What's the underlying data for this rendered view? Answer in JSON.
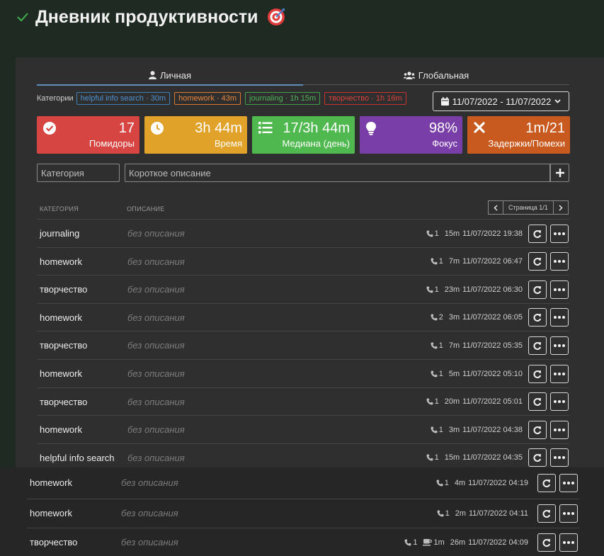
{
  "header": {
    "title": "Дневник продуктивности"
  },
  "tabs": [
    {
      "label": "Личная",
      "active": true
    },
    {
      "label": "Глобальная",
      "active": false
    }
  ],
  "categories": {
    "label": "Категории",
    "tags": [
      {
        "text": "helpful info search · 30m",
        "color": "#3f7fb8"
      },
      {
        "text": "homework · 43m",
        "color": "#e07a30"
      },
      {
        "text": "journaling · 1h 15m",
        "color": "#3fa14b"
      },
      {
        "text": "творчество · 1h 16m",
        "color": "#c8332f"
      }
    ]
  },
  "date_range": "11/07/2022 - 11/07/2022",
  "stats": [
    {
      "value": "17",
      "label": "Помидоры",
      "color": "#d64541",
      "icon": "check-circle-icon"
    },
    {
      "value": "3h 44m",
      "label": "Время",
      "color": "#e0a229",
      "icon": "clock-icon"
    },
    {
      "value": "17/3h 44m",
      "label": "Медиана (день)",
      "color": "#4fb84f",
      "icon": "list-icon"
    },
    {
      "value": "98%",
      "label": "Фокус",
      "color": "#7a3ea8",
      "icon": "lightbulb-icon"
    },
    {
      "value": "1m/21",
      "label": "Задержки/Помехи",
      "color": "#c95a1f",
      "icon": "times-icon"
    }
  ],
  "inputs": {
    "category_placeholder": "Категория",
    "description_placeholder": "Короткое описание"
  },
  "list": {
    "col_category": "Категория",
    "col_description": "Описание",
    "pager_text": "Страница 1/1",
    "rows": [
      {
        "category": "journaling",
        "description": "без описания",
        "calls": "1",
        "duration": "15m",
        "datetime": "11/07/2022 19:38"
      },
      {
        "category": "homework",
        "description": "без описания",
        "calls": "1",
        "duration": "7m",
        "datetime": "11/07/2022 06:47"
      },
      {
        "category": "творчество",
        "description": "без описания",
        "calls": "1",
        "duration": "23m",
        "datetime": "11/07/2022 06:30"
      },
      {
        "category": "homework",
        "description": "без описания",
        "calls": "2",
        "duration": "3m",
        "datetime": "11/07/2022 06:05"
      },
      {
        "category": "творчество",
        "description": "без описания",
        "calls": "1",
        "duration": "7m",
        "datetime": "11/07/2022 05:35"
      },
      {
        "category": "homework",
        "description": "без описания",
        "calls": "1",
        "duration": "5m",
        "datetime": "11/07/2022 05:10"
      },
      {
        "category": "творчество",
        "description": "без описания",
        "calls": "1",
        "duration": "20m",
        "datetime": "11/07/2022 05:01"
      },
      {
        "category": "homework",
        "description": "без описания",
        "calls": "1",
        "duration": "3m",
        "datetime": "11/07/2022 04:38"
      },
      {
        "category": "helpful info search",
        "description": "без описания",
        "calls": "1",
        "duration": "15m",
        "datetime": "11/07/2022 04:35"
      },
      {
        "category": "homework",
        "description": "без описания",
        "calls": "1",
        "duration": "4m",
        "datetime": "11/07/2022 04:19"
      },
      {
        "category": "homework",
        "description": "без описания",
        "calls": "1",
        "duration": "2m",
        "datetime": "11/07/2022 04:11"
      },
      {
        "category": "творчество",
        "description": "без описания",
        "calls": "1",
        "break": "1m",
        "duration": "26m",
        "datetime": "11/07/2022 04:09"
      }
    ]
  }
}
